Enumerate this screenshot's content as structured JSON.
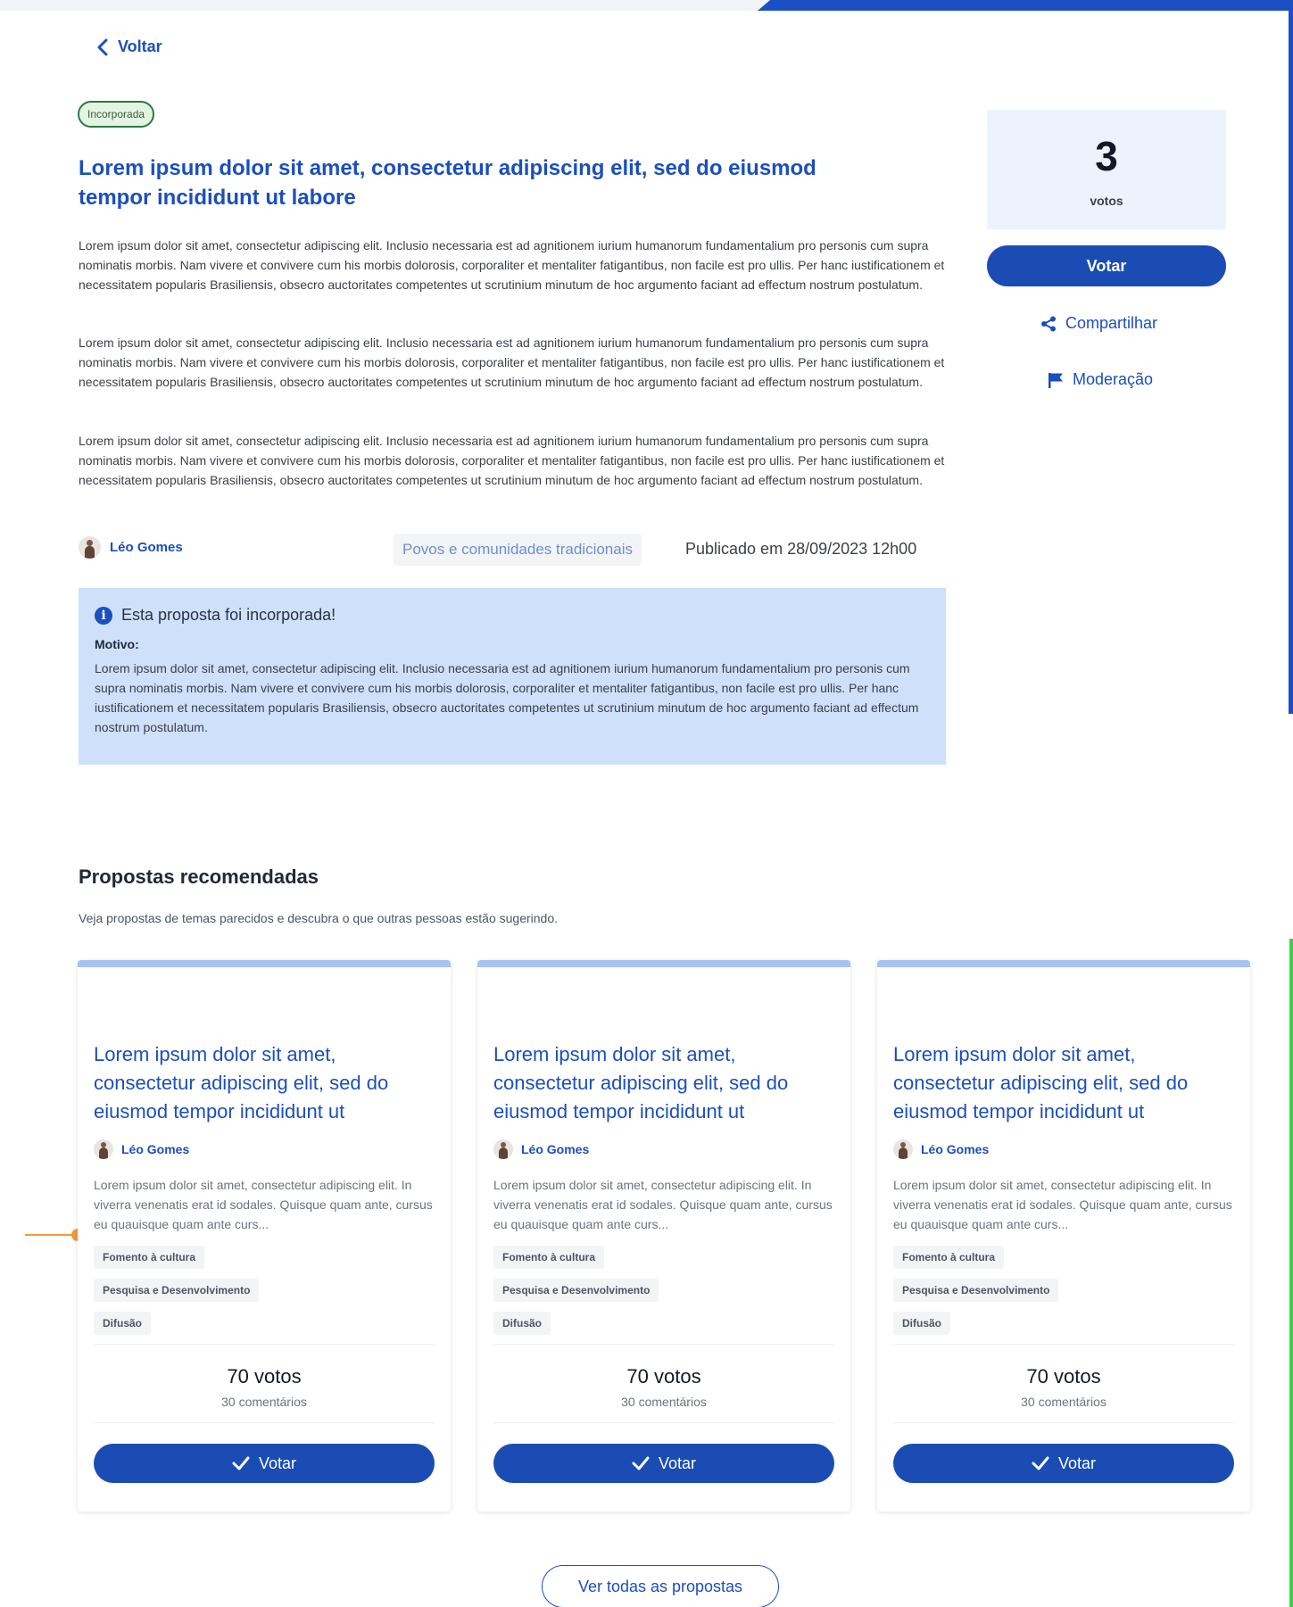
{
  "back": {
    "label": "Voltar"
  },
  "proposal": {
    "status_badge": "Incorporada",
    "title": "Lorem ipsum dolor sit amet, consectetur adipiscing elit, sed do eiusmod tempor incididunt ut labore",
    "paragraphs": [
      "Lorem ipsum dolor sit amet, consectetur adipiscing elit. Inclusio necessaria est ad agnitionem iurium humanorum fundamentalium pro personis cum supra nominatis morbis. Nam vivere et convivere cum his morbis dolorosis, corporaliter et mentaliter fatigantibus, non facile est pro ullis. Per hanc iustificationem et necessitatem popularis Brasiliensis, obsecro auctoritates competentes ut scrutinium minutum de hoc argumento faciant ad effectum nostrum postulatum.",
      "Lorem ipsum dolor sit amet, consectetur adipiscing elit. Inclusio necessaria est ad agnitionem iurium humanorum fundamentalium pro personis cum supra nominatis morbis. Nam vivere et convivere cum his morbis dolorosis, corporaliter et mentaliter fatigantibus, non facile est pro ullis. Per hanc iustificationem et necessitatem popularis Brasiliensis, obsecro auctoritates competentes ut scrutinium minutum de hoc argumento faciant ad effectum nostrum postulatum.",
      "Lorem ipsum dolor sit amet, consectetur adipiscing elit. Inclusio necessaria est ad agnitionem iurium humanorum fundamentalium pro personis cum supra nominatis morbis. Nam vivere et convivere cum his morbis dolorosis, corporaliter et mentaliter fatigantibus, non facile est pro ullis. Per hanc iustificationem et necessitatem popularis Brasiliensis, obsecro auctoritates competentes ut scrutinium minutum de hoc argumento faciant ad effectum nostrum postulatum."
    ],
    "author": "Léo Gomes",
    "category": "Povos e comunidades tradicionais",
    "published": "Publicado em 28/09/2023 12h00",
    "info_box": {
      "heading": "Esta proposta foi incorporada!",
      "motivo_label": "Motivo:",
      "motivo_text": "Lorem ipsum dolor sit amet, consectetur adipiscing elit. Inclusio necessaria est ad agnitionem iurium humanorum fundamentalium pro personis cum supra nominatis morbis. Nam vivere et convivere cum his morbis dolorosis, corporaliter et mentaliter fatigantibus, non facile est pro ullis. Per hanc iustificationem et necessitatem popularis Brasiliensis, obsecro auctoritates competentes ut scrutinium minutum de hoc argumento faciant ad effectum nostrum postulatum."
    }
  },
  "sidebar": {
    "vote_count": "3",
    "vote_label": "votos",
    "vote_button": "Votar",
    "share_label": "Compartilhar",
    "moderation_label": "Moderação"
  },
  "recommended": {
    "title": "Propostas recomendadas",
    "subtitle": "Veja propostas de temas parecidos e descubra o que outras pessoas estão sugerindo.",
    "cards": [
      {
        "title": "Lorem ipsum dolor sit amet, consectetur adipiscing elit, sed do eiusmod tempor incididunt ut",
        "author": "Léo Gomes",
        "description": "Lorem ipsum dolor sit amet, consectetur adipiscing elit. In viverra venenatis erat id sodales. Quisque quam ante, cursus eu quauisque quam ante curs...",
        "tags": [
          "Fomento à cultura",
          "Pesquisa e Desenvolvimento",
          "Difusão"
        ],
        "votes": "70 votos",
        "comments": "30 comentários",
        "button": "Votar"
      },
      {
        "title": "Lorem ipsum dolor sit amet, consectetur adipiscing elit, sed do eiusmod tempor incididunt ut",
        "author": "Léo Gomes",
        "description": "Lorem ipsum dolor sit amet, consectetur adipiscing elit. In viverra venenatis erat id sodales. Quisque quam ante, cursus eu quauisque quam ante curs...",
        "tags": [
          "Fomento à cultura",
          "Pesquisa e Desenvolvimento",
          "Difusão"
        ],
        "votes": "70 votos",
        "comments": "30 comentários",
        "button": "Votar"
      },
      {
        "title": "Lorem ipsum dolor sit amet, consectetur adipiscing elit, sed do eiusmod tempor incididunt ut",
        "author": "Léo Gomes",
        "description": "Lorem ipsum dolor sit amet, consectetur adipiscing elit. In viverra venenatis erat id sodales. Quisque quam ante, cursus eu quauisque quam ante curs...",
        "tags": [
          "Fomento à cultura",
          "Pesquisa e Desenvolvimento",
          "Difusão"
        ],
        "votes": "70 votos",
        "comments": "30 comentários",
        "button": "Votar"
      }
    ],
    "see_all": "Ver todas as propostas"
  },
  "colors": {
    "primary": "#1a4cb4",
    "link": "#1b4fbd",
    "info_bg": "#cfe0fb",
    "badge_border": "#2c7a3f",
    "accent_orange": "#f29a3a",
    "edge_green": "#3ccf4e"
  },
  "icons": {
    "back": "chevron-left-icon",
    "share": "share-icon",
    "moderation": "flag-icon",
    "info": "info-icon",
    "check": "check-icon"
  }
}
